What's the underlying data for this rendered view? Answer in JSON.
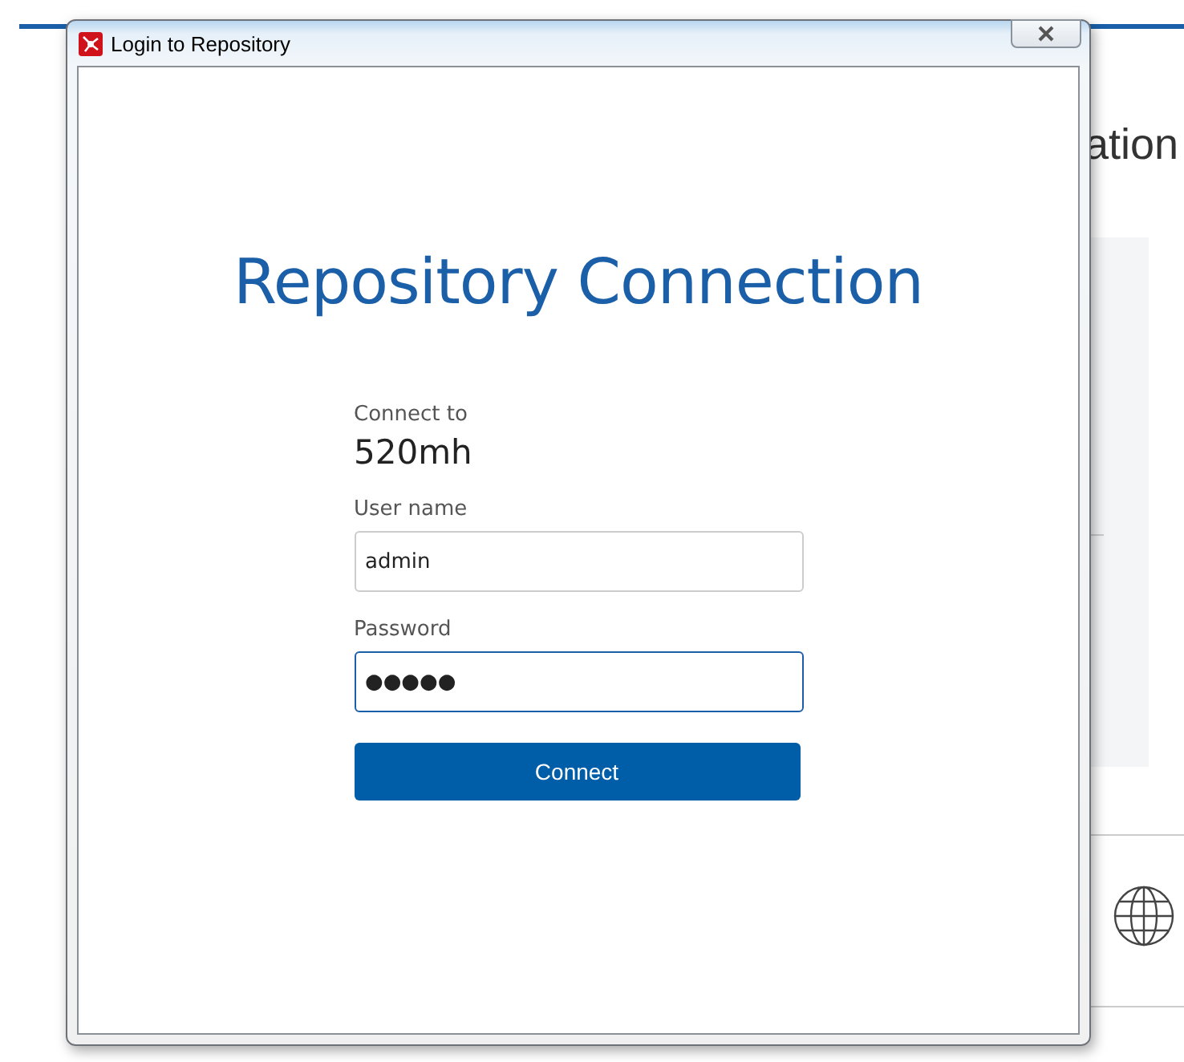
{
  "background": {
    "heading_fragment": "ation"
  },
  "window": {
    "title": "Login to Repository"
  },
  "dialog": {
    "heading": "Repository Connection",
    "connect_to_label": "Connect to",
    "connect_to_value": "520mh",
    "fields": [
      {
        "label": "User name",
        "value": "admin",
        "focused": false
      },
      {
        "label": "Password",
        "value": "●●●●●",
        "focused": true
      }
    ],
    "button": "Connect"
  }
}
